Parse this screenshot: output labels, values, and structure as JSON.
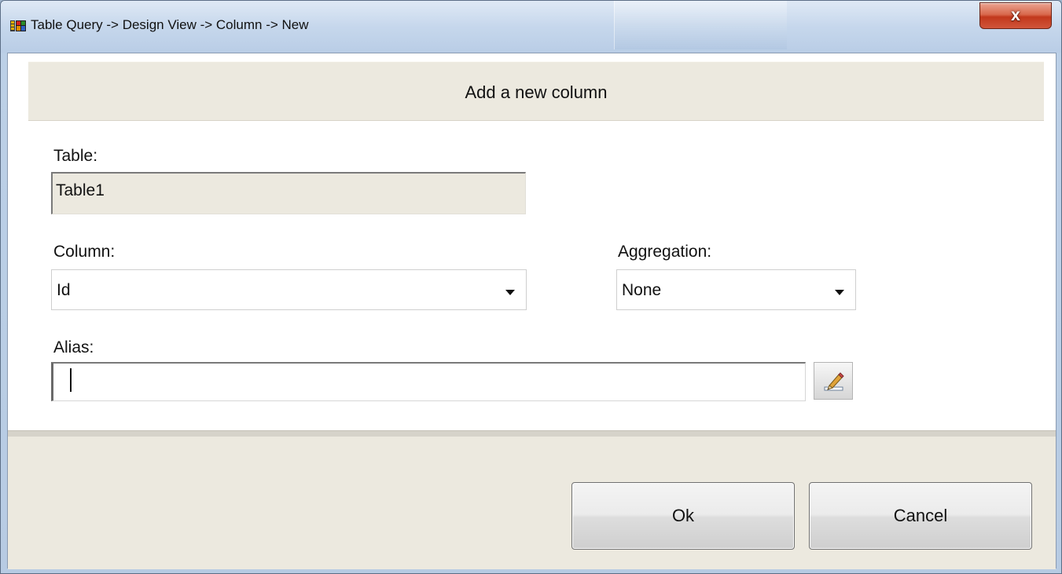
{
  "window": {
    "title": "Table Query -> Design View -> Column -> New",
    "close_label": "x"
  },
  "header": {
    "title": "Add a new column"
  },
  "form": {
    "table_label": "Table:",
    "table_value": "Table1",
    "column_label": "Column:",
    "column_value": "Id",
    "aggregation_label": "Aggregation:",
    "aggregation_value": "None",
    "alias_label": "Alias:",
    "alias_value": ""
  },
  "buttons": {
    "ok": "Ok",
    "cancel": "Cancel"
  },
  "icons": {
    "app": "table-query-icon",
    "close": "close-icon",
    "dropdown": "chevron-down-icon",
    "edit": "pencil-icon"
  },
  "colors": {
    "panel": "#ece9df",
    "title_bar": "#c6d7ec",
    "close_button": "#c2381c"
  }
}
